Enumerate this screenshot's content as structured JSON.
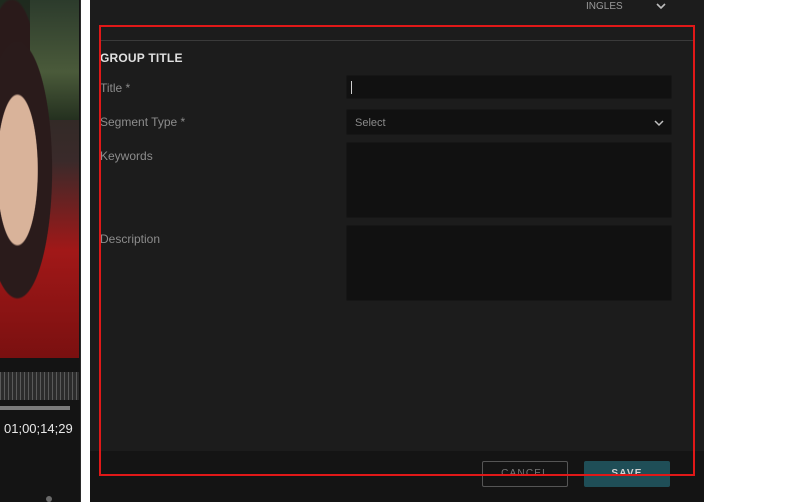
{
  "video": {
    "timecode": "01;00;14;29"
  },
  "header": {
    "language": "INGLES"
  },
  "form": {
    "section_title": "GROUP TITLE",
    "title_label": "Title *",
    "title_value": "",
    "segment_type_label": "Segment Type *",
    "segment_type_placeholder": "Select",
    "keywords_label": "Keywords",
    "description_label": "Description"
  },
  "footer": {
    "cancel_label": "CANCEL",
    "save_label": "SAVE"
  },
  "colors": {
    "highlight": "#e01818",
    "save_button": "#1f4e57",
    "panel": "#1c1c1c"
  },
  "icons": {
    "language_dropdown": "chevron-down-icon",
    "segment_dropdown": "chevron-down-icon"
  }
}
